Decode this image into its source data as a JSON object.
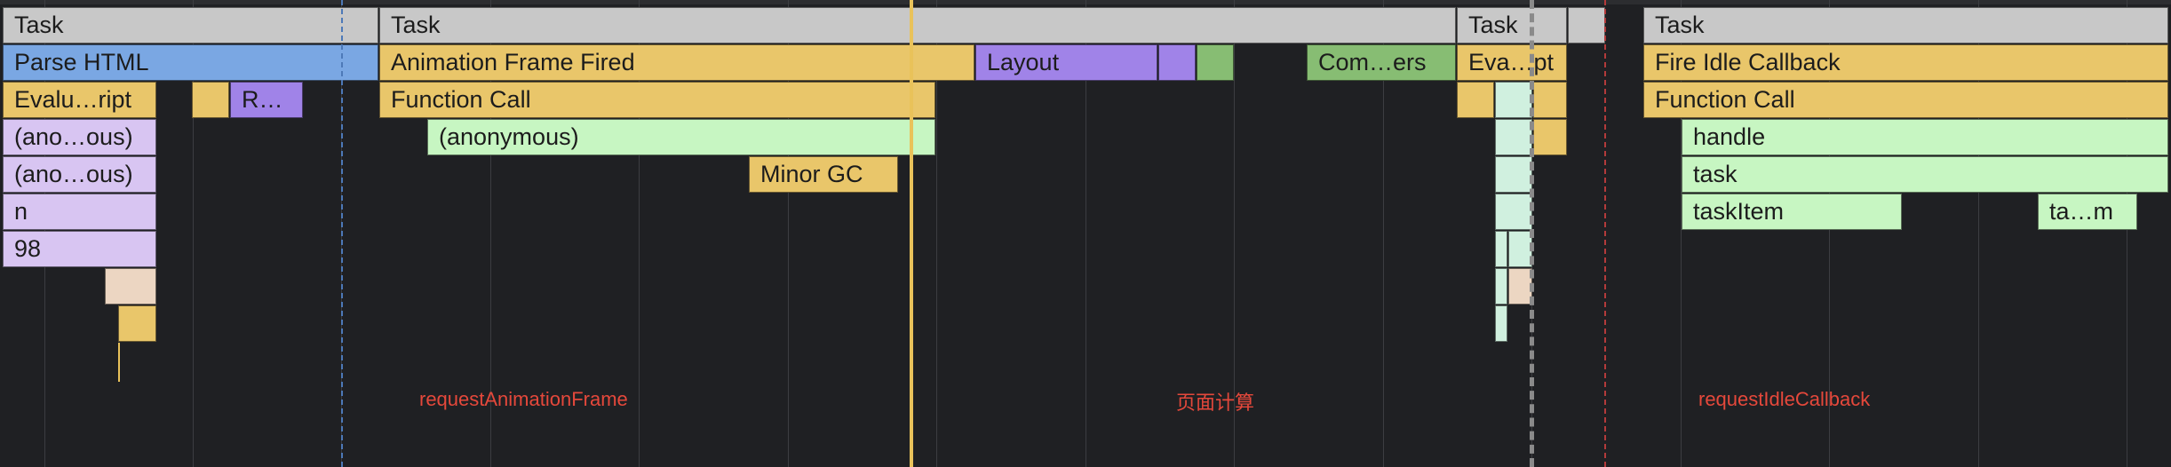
{
  "colors": {
    "task": "#c8c8c8",
    "parse_html": "#7aa7e3",
    "scripting": "#e9c66a",
    "rendering": "#a083e8",
    "painting": "#87bd73",
    "js_function": "#c7f6c2",
    "idle_marker": "#b33a3a"
  },
  "blocks": [
    {
      "label": "Task"
    },
    {
      "label": "Task"
    },
    {
      "label": "Task"
    },
    {
      "label": ""
    },
    {
      "label": "Task"
    },
    {
      "label": "Parse HTML"
    },
    {
      "label": "Animation Frame Fired"
    },
    {
      "label": "Layout"
    },
    {
      "label": ""
    },
    {
      "label": ""
    },
    {
      "label": "Com…ers"
    },
    {
      "label": "Eva…pt"
    },
    {
      "label": "Fire Idle Callback"
    },
    {
      "label": "Evalu…ript"
    },
    {
      "label": ""
    },
    {
      "label": "R…"
    },
    {
      "label": "Function Call"
    },
    {
      "label": ""
    },
    {
      "label": ""
    },
    {
      "label": ""
    },
    {
      "label": "Function Call"
    },
    {
      "label": "(ano…ous)"
    },
    {
      "label": "(anonymous)"
    },
    {
      "label": ""
    },
    {
      "label": ""
    },
    {
      "label": "handle"
    },
    {
      "label": "(ano…ous)"
    },
    {
      "label": "Minor GC"
    },
    {
      "label": ""
    },
    {
      "label": "task"
    },
    {
      "label": "n"
    },
    {
      "label": ""
    },
    {
      "label": "taskItem"
    },
    {
      "label": "ta…m"
    },
    {
      "label": "98"
    },
    {
      "label": ""
    },
    {
      "label": ""
    },
    {
      "label": ""
    },
    {
      "label": ""
    },
    {
      "label": ""
    },
    {
      "label": ""
    },
    {
      "label": ""
    }
  ],
  "annotations": {
    "raf": "requestAnimationFrame",
    "page_calc": "页面计算",
    "ric": "requestIdleCallback"
  }
}
